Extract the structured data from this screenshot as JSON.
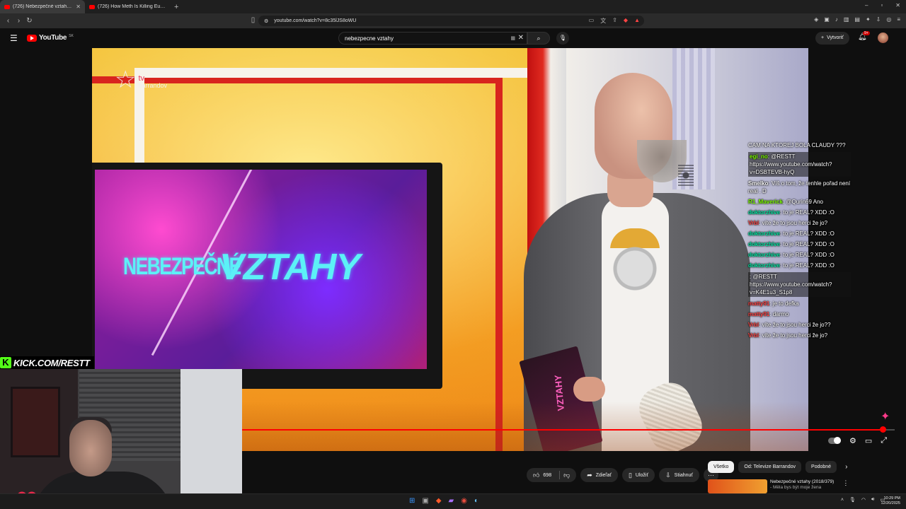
{
  "browser": {
    "tabs": [
      {
        "label": "(726) Nebezpečné vztahy (20",
        "active": true
      },
      {
        "label": "(726) How Meth Is Killing Europe - Y",
        "active": false
      }
    ],
    "url": "youtube.com/watch?v=8c35lJS8oWU"
  },
  "youtube": {
    "logo": "YouTube",
    "country": "SK",
    "search_value": "nebezpecne vztahy",
    "create_label": "Vytvoriť",
    "notif_badge": "9+"
  },
  "video": {
    "channel_logo": {
      "top": "tv",
      "bottom": "barrandov"
    },
    "screen_title_a": "NEBEZPEČNÉ",
    "screen_title_b": "VZTAHY",
    "folder_text": "VZTAHY",
    "progress": 0.985
  },
  "chat": [
    {
      "user": "",
      "text": "CAM NA KTOREJ BOLA CLAUDY ???",
      "user_color": "#ff4444",
      "hl": false
    },
    {
      "user": "egi_no",
      "text": ": @RESTT https://www.youtube.com/watch?v=DSBTEVB-hyQ",
      "user_color": "#7cfc00",
      "hl": true
    },
    {
      "user": "Smelko",
      "text": ": Víš o tom, že tenhle pořad není real . D",
      "user_color": "#ffffff",
      "hl": false
    },
    {
      "user": "R1_Maverick",
      "text": ": @Qurin69 Ano",
      "user_color": "#7cfc00",
      "hl": false
    },
    {
      "user": "doktorzhive",
      "text": ": to je REAL? XDD :O",
      "user_color": "#00e5a0",
      "hl": false
    },
    {
      "user": "Vrbl",
      "text": ": víte že to jsou herci že jo?",
      "user_color": "#ff4444",
      "hl": false
    },
    {
      "user": "doktorzhive",
      "text": ": to je REAL? XDD :O",
      "user_color": "#00e5a0",
      "hl": false
    },
    {
      "user": "doktorzhive",
      "text": ": to je REAL? XDD :O",
      "user_color": "#00e5a0",
      "hl": false
    },
    {
      "user": "doktorzhive",
      "text": ": to je REAL? XDD :O",
      "user_color": "#00e5a0",
      "hl": false
    },
    {
      "user": "doktorzhive",
      "text": ": to je REAL? XDD :O",
      "user_color": "#00e5a0",
      "hl": false
    },
    {
      "user": "",
      "text": ": @RESTT https://www.youtube.com/watch?v=K4E1u3_S1p8",
      "user_color": "#ff4444",
      "hl": true
    },
    {
      "user": "matty91",
      "text": ": je to defka",
      "user_color": "#ff4444",
      "hl": false
    },
    {
      "user": "matty91",
      "text": ": darmo",
      "user_color": "#ff4444",
      "hl": false
    },
    {
      "user": "Vrbl",
      "text": ": víte že to jsou herci že jo??",
      "user_color": "#ff4444",
      "hl": false
    },
    {
      "user": "Vrbl",
      "text": ": víte že to jsou herci že jo?",
      "user_color": "#ff4444",
      "hl": false
    }
  ],
  "stream": {
    "kick_label": "KICK.COM/RESTT"
  },
  "actions": {
    "like_count": "698",
    "share": "Zdieľať",
    "save": "Uložiť",
    "download": "Stiahnuť"
  },
  "chips": [
    "Všetko",
    "Od: Televize Barrandov",
    "Podobné"
  ],
  "recommended": {
    "title": "Nebezpečné vztahy (2018/379)",
    "subtitle": "- Měla bys být moje žena"
  },
  "taskbar": {
    "time": "10:29 PM",
    "date": "12/20/2025"
  },
  "colors": {
    "accent": "#ff0000",
    "kick": "#53fc18"
  }
}
